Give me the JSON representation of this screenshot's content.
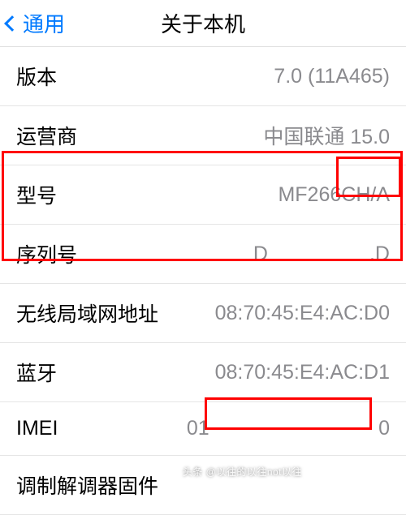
{
  "header": {
    "back_label": "通用",
    "title": "关于本机"
  },
  "rows": [
    {
      "label": "版本",
      "value": "7.0 (11A465)"
    },
    {
      "label": "运营商",
      "value": "中国联通 15.0"
    },
    {
      "label": "型号",
      "value": "MF266CH/A"
    },
    {
      "label": "序列号",
      "value": "D                  .D"
    },
    {
      "label": "无线局域网地址",
      "value": "08:70:45:E4:AC:D0"
    },
    {
      "label": "蓝牙",
      "value": "08:70:45:E4:AC:D1"
    },
    {
      "label": "IMEI",
      "value": "01                              0"
    },
    {
      "label": "调制解调器固件",
      "value": ""
    }
  ],
  "watermark": "头条 @以往的以往not以往"
}
